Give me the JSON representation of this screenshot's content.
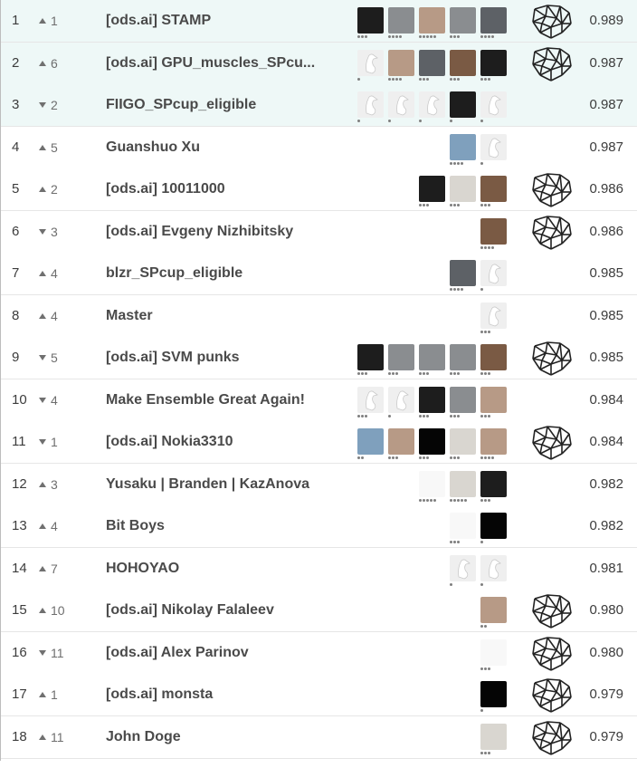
{
  "leaderboard": {
    "rows": [
      {
        "rank": "1",
        "change_dir": "up",
        "change": "1",
        "team": "[ods.ai] STAMP",
        "score": "0.989",
        "medal": true,
        "highlight": true,
        "members": [
          [
            "dark",
            3
          ],
          [
            "photo",
            4
          ],
          [
            "face",
            5
          ],
          [
            "photo",
            3
          ],
          [
            "gray",
            4
          ]
        ]
      },
      {
        "rank": "2",
        "change_dir": "up",
        "change": "6",
        "team": "[ods.ai] GPU_muscles_SPcu...",
        "score": "0.987",
        "medal": true,
        "highlight": true,
        "members": [
          [
            "goose",
            1
          ],
          [
            "face",
            4
          ],
          [
            "gray",
            3
          ],
          [
            "brown",
            3
          ],
          [
            "dark",
            3
          ]
        ]
      },
      {
        "rank": "3",
        "change_dir": "down",
        "change": "2",
        "team": "FIIGO_SPcup_eligible",
        "score": "0.987",
        "medal": false,
        "highlight": true,
        "members": [
          [
            "goose",
            1
          ],
          [
            "goose",
            1
          ],
          [
            "goose",
            1
          ],
          [
            "dark",
            1
          ],
          [
            "goose",
            1
          ]
        ]
      },
      {
        "rank": "4",
        "change_dir": "up",
        "change": "5",
        "team": "Guanshuo Xu",
        "score": "0.987",
        "medal": false,
        "highlight": false,
        "members": [
          [
            "blue",
            4
          ],
          [
            "goose",
            1
          ]
        ]
      },
      {
        "rank": "5",
        "change_dir": "up",
        "change": "2",
        "team": "[ods.ai] 10011000",
        "score": "0.986",
        "medal": true,
        "highlight": false,
        "members": [
          [
            "dark",
            3
          ],
          [
            "light",
            3
          ],
          [
            "brown",
            3
          ]
        ]
      },
      {
        "rank": "6",
        "change_dir": "down",
        "change": "3",
        "team": "[ods.ai] Evgeny Nizhibitsky",
        "score": "0.986",
        "medal": true,
        "highlight": false,
        "members": [
          [
            "brown",
            4
          ]
        ]
      },
      {
        "rank": "7",
        "change_dir": "up",
        "change": "4",
        "team": "blzr_SPcup_eligible",
        "score": "0.985",
        "medal": false,
        "highlight": false,
        "members": [
          [
            "gray",
            4
          ],
          [
            "goose",
            1
          ]
        ]
      },
      {
        "rank": "8",
        "change_dir": "up",
        "change": "4",
        "team": "Master",
        "score": "0.985",
        "medal": false,
        "highlight": false,
        "members": [
          [
            "goose",
            3
          ]
        ]
      },
      {
        "rank": "9",
        "change_dir": "down",
        "change": "5",
        "team": "[ods.ai] SVM punks",
        "score": "0.985",
        "medal": true,
        "highlight": false,
        "members": [
          [
            "dark",
            3
          ],
          [
            "photo",
            3
          ],
          [
            "photo",
            3
          ],
          [
            "photo",
            3
          ],
          [
            "brown",
            3
          ]
        ]
      },
      {
        "rank": "10",
        "change_dir": "down",
        "change": "4",
        "team": "Make Ensemble Great Again!",
        "score": "0.984",
        "medal": false,
        "highlight": false,
        "members": [
          [
            "goose",
            3
          ],
          [
            "goose",
            1
          ],
          [
            "dark",
            3
          ],
          [
            "photo",
            3
          ],
          [
            "face",
            3
          ]
        ]
      },
      {
        "rank": "11",
        "change_dir": "down",
        "change": "1",
        "team": "[ods.ai] Nokia3310",
        "score": "0.984",
        "medal": true,
        "highlight": false,
        "members": [
          [
            "blue",
            2
          ],
          [
            "face",
            3
          ],
          [
            "black",
            3
          ],
          [
            "light",
            3
          ],
          [
            "face",
            4
          ]
        ]
      },
      {
        "rank": "12",
        "change_dir": "up",
        "change": "3",
        "team": "Yusaku | Branden | KazAnova",
        "score": "0.982",
        "medal": false,
        "highlight": false,
        "members": [
          [
            "white",
            5
          ],
          [
            "light",
            5
          ],
          [
            "dark",
            3
          ]
        ]
      },
      {
        "rank": "13",
        "change_dir": "up",
        "change": "4",
        "team": "Bit Boys",
        "score": "0.982",
        "medal": false,
        "highlight": false,
        "members": [
          [
            "white",
            3
          ],
          [
            "black",
            1
          ]
        ]
      },
      {
        "rank": "14",
        "change_dir": "up",
        "change": "7",
        "team": "HOHOYAO",
        "score": "0.981",
        "medal": false,
        "highlight": false,
        "members": [
          [
            "goose",
            1
          ],
          [
            "goose",
            1
          ]
        ]
      },
      {
        "rank": "15",
        "change_dir": "up",
        "change": "10",
        "team": "[ods.ai] Nikolay Falaleev",
        "score": "0.980",
        "medal": true,
        "highlight": false,
        "members": [
          [
            "face",
            2
          ]
        ]
      },
      {
        "rank": "16",
        "change_dir": "down",
        "change": "11",
        "team": "[ods.ai] Alex Parinov",
        "score": "0.980",
        "medal": true,
        "highlight": false,
        "members": [
          [
            "white",
            3
          ]
        ]
      },
      {
        "rank": "17",
        "change_dir": "up",
        "change": "1",
        "team": "[ods.ai] monsta",
        "score": "0.979",
        "medal": true,
        "highlight": false,
        "members": [
          [
            "black",
            1
          ]
        ]
      },
      {
        "rank": "18",
        "change_dir": "up",
        "change": "11",
        "team": "John Doge",
        "score": "0.979",
        "medal": true,
        "highlight": false,
        "members": [
          [
            "light",
            3
          ]
        ]
      }
    ]
  }
}
